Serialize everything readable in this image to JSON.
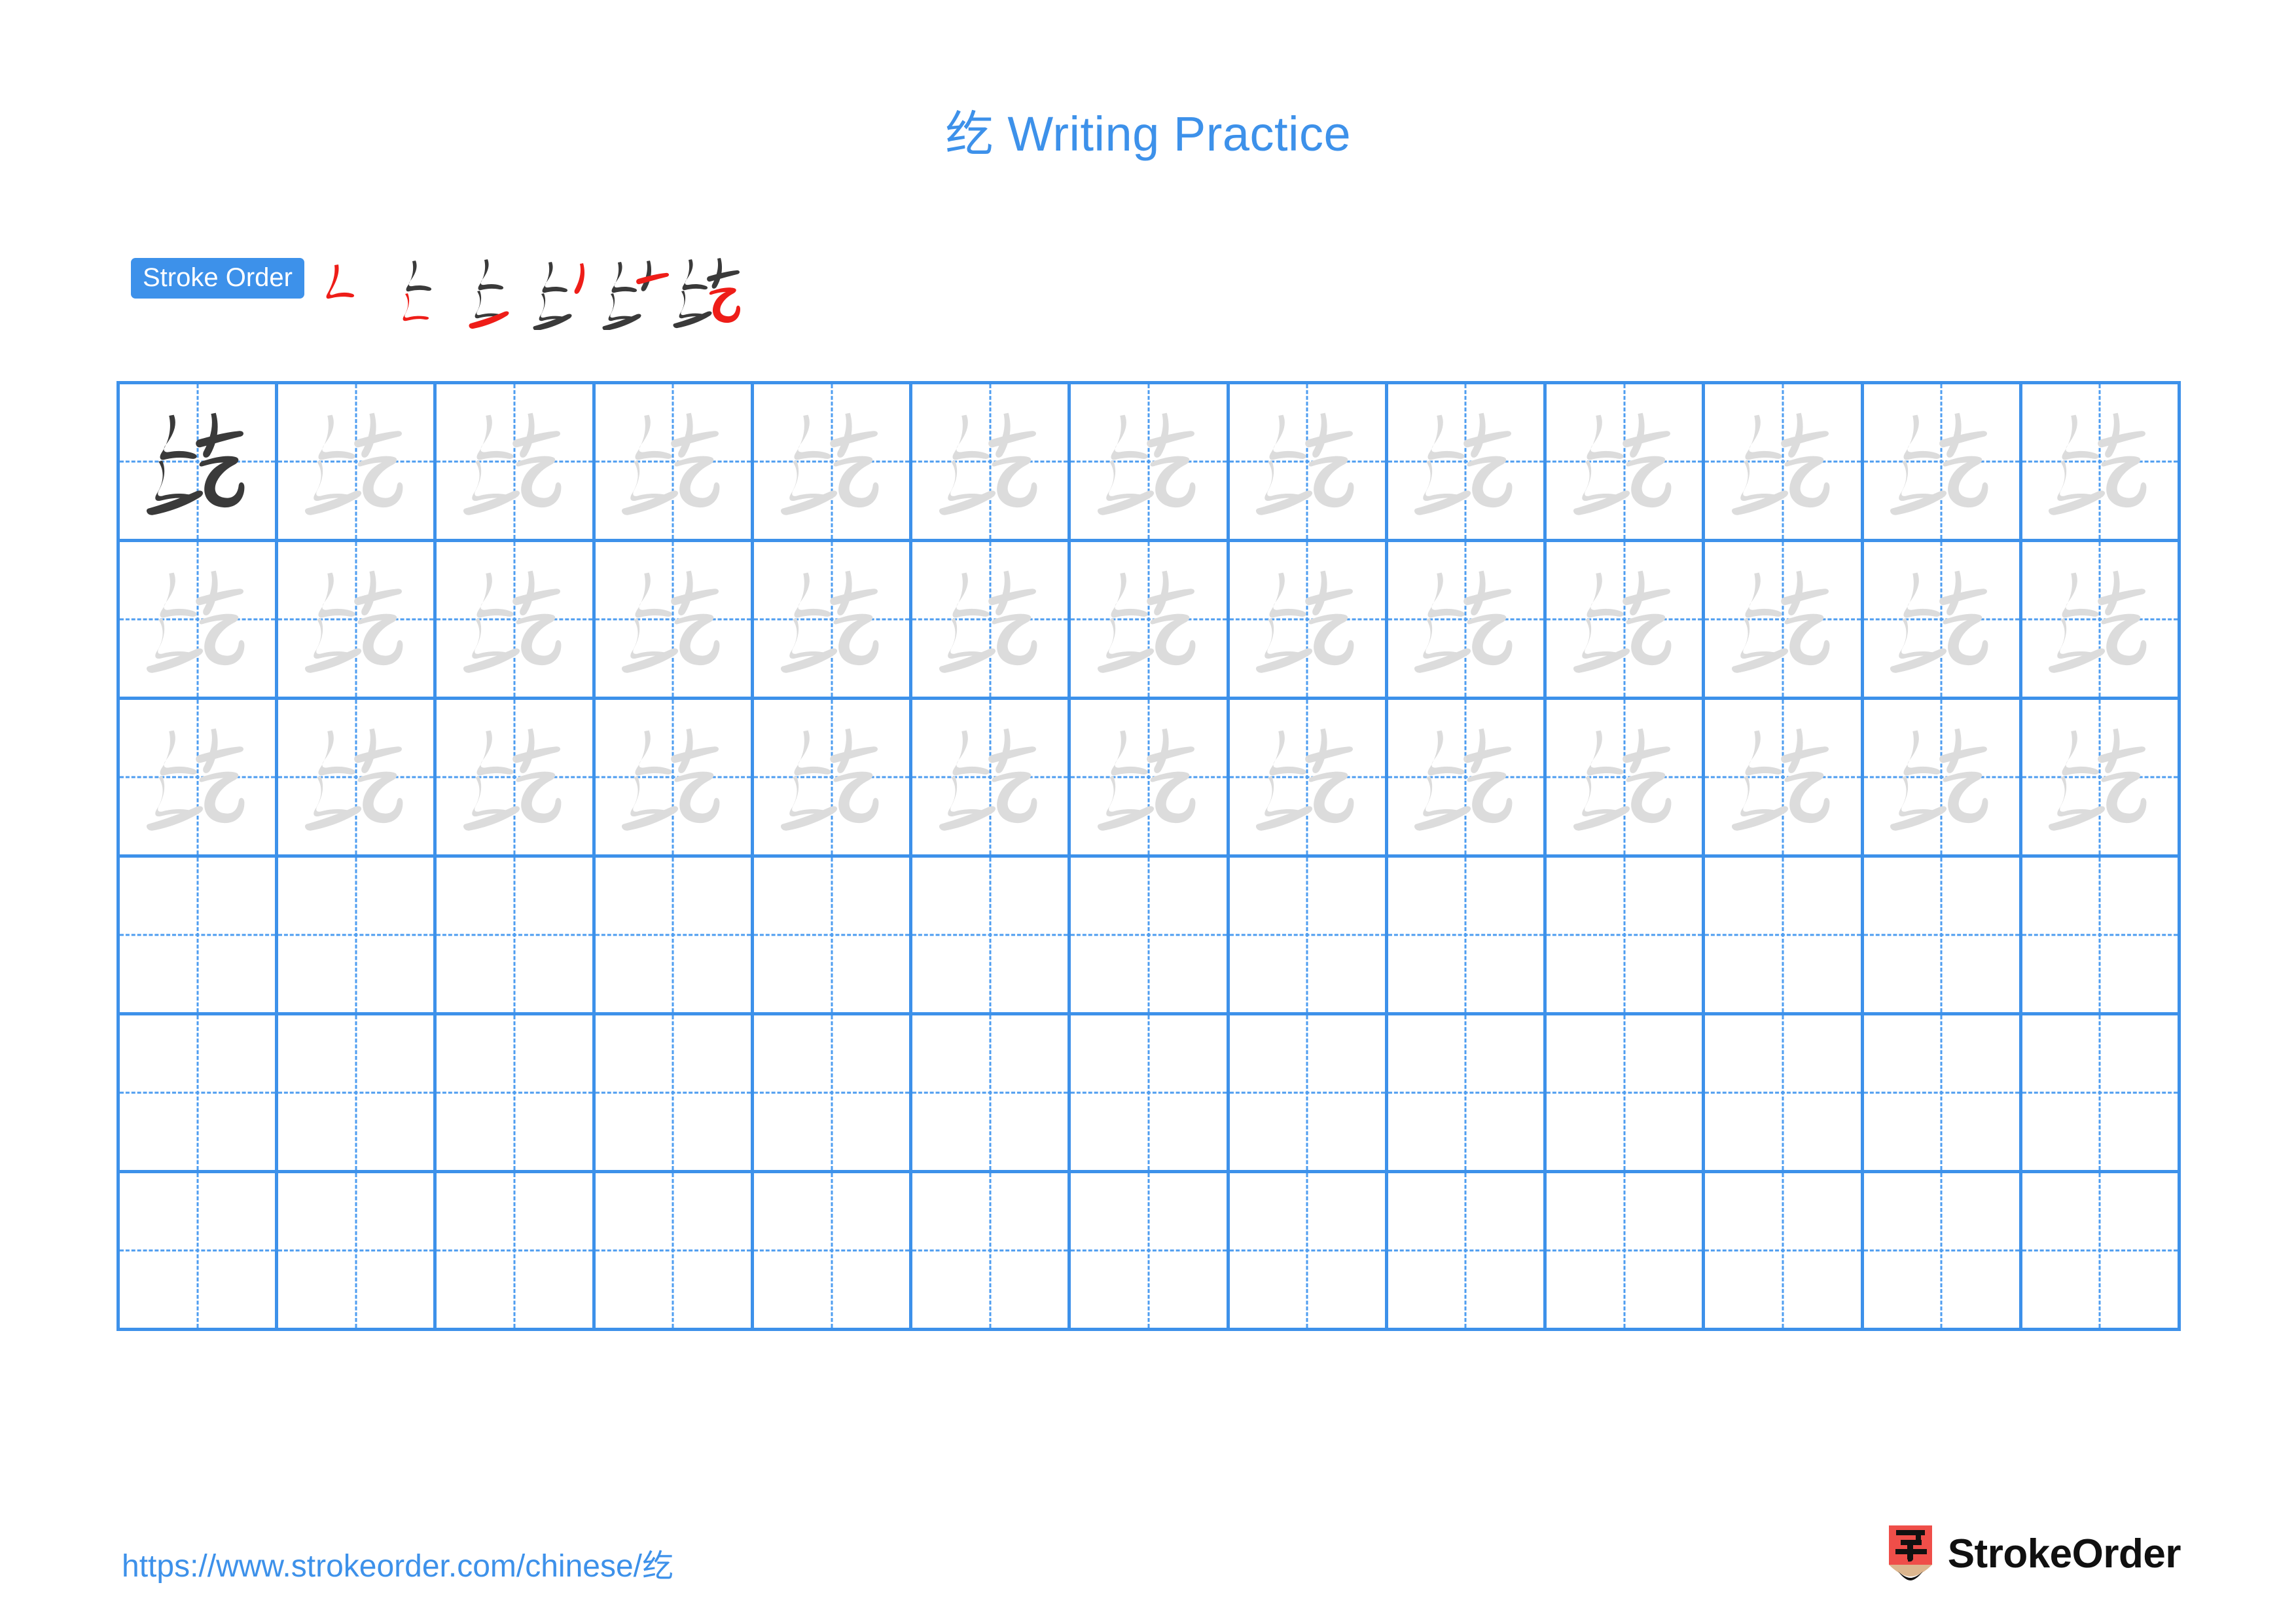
{
  "character": "纥",
  "header": {
    "title": "纥 Writing Practice",
    "title_color": "#3d91ea"
  },
  "stroke_order": {
    "badge_label": "Stroke Order",
    "badge_bg": "#3d91ea",
    "badge_text_color": "#ffffff",
    "total_strokes": 6,
    "new_stroke_color": "#ee1d18",
    "prior_stroke_color": "#3a3a3a",
    "steps": [
      {
        "index": 1,
        "strokes_shown": 1,
        "new_stroke": "撇折 (piezhe)"
      },
      {
        "index": 2,
        "strokes_shown": 2,
        "new_stroke": "撇折 (piezhe)"
      },
      {
        "index": 3,
        "strokes_shown": 3,
        "new_stroke": "提 (ti)"
      },
      {
        "index": 4,
        "strokes_shown": 4,
        "new_stroke": "撇 (pie)"
      },
      {
        "index": 5,
        "strokes_shown": 5,
        "new_stroke": "横 (heng)"
      },
      {
        "index": 6,
        "strokes_shown": 6,
        "new_stroke": "横折弯钩 (hengzhewangou)"
      }
    ]
  },
  "grid": {
    "columns": 13,
    "rows": 6,
    "line_color": "#3d91ea",
    "guide_color": "#4e9df0",
    "example_color": "#3a3a3a",
    "trace_color": "#dcdcdc",
    "cells": [
      [
        "example",
        "trace",
        "trace",
        "trace",
        "trace",
        "trace",
        "trace",
        "trace",
        "trace",
        "trace",
        "trace",
        "trace",
        "trace"
      ],
      [
        "trace",
        "trace",
        "trace",
        "trace",
        "trace",
        "trace",
        "trace",
        "trace",
        "trace",
        "trace",
        "trace",
        "trace",
        "trace"
      ],
      [
        "trace",
        "trace",
        "trace",
        "trace",
        "trace",
        "trace",
        "trace",
        "trace",
        "trace",
        "trace",
        "trace",
        "trace",
        "trace"
      ],
      [
        "empty",
        "empty",
        "empty",
        "empty",
        "empty",
        "empty",
        "empty",
        "empty",
        "empty",
        "empty",
        "empty",
        "empty",
        "empty"
      ],
      [
        "empty",
        "empty",
        "empty",
        "empty",
        "empty",
        "empty",
        "empty",
        "empty",
        "empty",
        "empty",
        "empty",
        "empty",
        "empty"
      ],
      [
        "empty",
        "empty",
        "empty",
        "empty",
        "empty",
        "empty",
        "empty",
        "empty",
        "empty",
        "empty",
        "empty",
        "empty",
        "empty"
      ]
    ]
  },
  "footer": {
    "url": "https://www.strokeorder.com/chinese/纥",
    "url_color": "#3d91ea",
    "brand_name": "StrokeOrder",
    "logo": {
      "body_color": "#ef4e49",
      "wood_color": "#dcb68e",
      "tip_color": "#111111",
      "glyph": "字"
    }
  }
}
